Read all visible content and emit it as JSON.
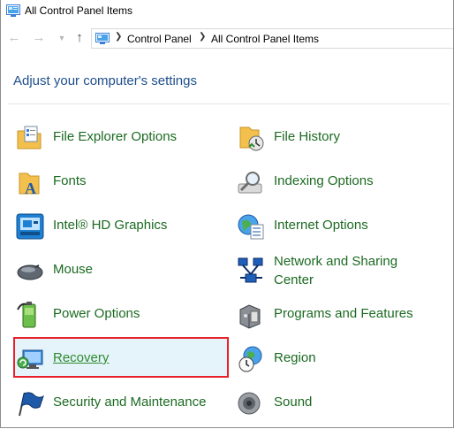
{
  "window": {
    "title": "All Control Panel Items"
  },
  "nav": {
    "back_icon": "back-arrow-icon",
    "forward_icon": "forward-arrow-icon",
    "recent_icon": "chevron-down-icon",
    "up_icon": "up-arrow-icon",
    "breadcrumbs": [
      "Control Panel",
      "All Control Panel Items"
    ]
  },
  "heading": "Adjust your computer's settings",
  "colors": {
    "link_green": "#1b6a21",
    "heading_blue": "#1e4e8c",
    "selection_border": "#e8202a",
    "selection_fill": "#e5f3fb"
  },
  "items": [
    {
      "label": "File Explorer Options",
      "icon": "folder-options-icon"
    },
    {
      "label": "File History",
      "icon": "file-history-icon"
    },
    {
      "label": "Fonts",
      "icon": "fonts-folder-icon"
    },
    {
      "label": "Indexing Options",
      "icon": "magnifier-icon"
    },
    {
      "label": "Intel® HD Graphics",
      "icon": "intel-graphics-icon"
    },
    {
      "label": "Internet Options",
      "icon": "globe-checklist-icon"
    },
    {
      "label": "Mouse",
      "icon": "mouse-icon"
    },
    {
      "label": "Network and Sharing",
      "label2": "Center",
      "icon": "network-icon"
    },
    {
      "label": "Power Options",
      "icon": "battery-icon"
    },
    {
      "label": "Programs and Features",
      "icon": "programs-box-icon"
    },
    {
      "label": "Recovery",
      "icon": "recovery-monitor-icon",
      "selected": true
    },
    {
      "label": "Region",
      "icon": "globe-clock-icon"
    },
    {
      "label": "Security and Maintenance",
      "icon": "flag-icon"
    },
    {
      "label": "Sound",
      "icon": "speaker-icon"
    }
  ]
}
